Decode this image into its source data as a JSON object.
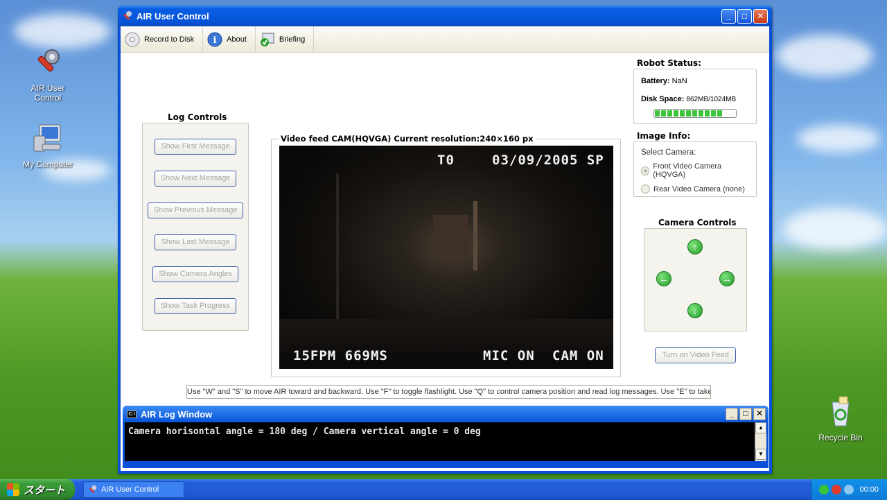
{
  "desktop": {
    "icons": [
      {
        "label": "AIR User Control"
      },
      {
        "label": "My Computer"
      },
      {
        "label": "Recycle Bin"
      }
    ]
  },
  "window": {
    "title": "AIR User Control",
    "controls": {
      "minimize": "_",
      "maximize": "□",
      "close": "✕"
    }
  },
  "toolbar": {
    "record_label": "Record to Disk",
    "about_label": "About",
    "briefing_label": "Briefing"
  },
  "log_controls": {
    "title": "Log Controls",
    "buttons": [
      "Show First Message",
      "Show Next Message",
      "Show Previous Message",
      "Show Last Message",
      "Show Camera Angles",
      "Show Task Progress"
    ]
  },
  "video": {
    "title": "Video feed CAM(HQVGA) Current resolution:240×160 px",
    "osd_top_left": "T0",
    "osd_top_right": "03/09/2005 SP",
    "osd_bottom_left": "15FPM 669MS",
    "osd_bottom_mic": "MIC ON",
    "osd_bottom_cam": "CAM ON"
  },
  "robot_status": {
    "title": "Robot Status:",
    "battery_label": "Battery:",
    "battery_value": "NaN",
    "disk_label": "Disk Space:",
    "disk_value": "862MB/1024MB",
    "disk_fraction": 0.84
  },
  "image_info": {
    "title": "Image Info:",
    "select_label": "Select Camera:",
    "options": [
      {
        "label": "Front Video Camera (HQVGA)",
        "selected": true
      },
      {
        "label": "Rear Video Camera (none)",
        "selected": false
      }
    ]
  },
  "camera_controls": {
    "title": "Camera Controls",
    "turn_on_label": "Turn on Video Feed"
  },
  "hint": "Use \"W\" and \"S\" to move AIR toward and backward. Use \"F\" to toggle flashlight. Use \"Q\" to control camera position and read log messages. Use \"E\" to take photos.",
  "log_window": {
    "title": "AIR Log Window",
    "text": "Camera horisontal angle = 180 deg / Camera vertical angle = 0 deg"
  },
  "taskbar": {
    "start_label": "スタート",
    "task_label": "AIR User Control",
    "clock": "00:00"
  },
  "colors": {
    "progress_green": "#3cc43c",
    "xp_blue": "#0a50d8"
  }
}
